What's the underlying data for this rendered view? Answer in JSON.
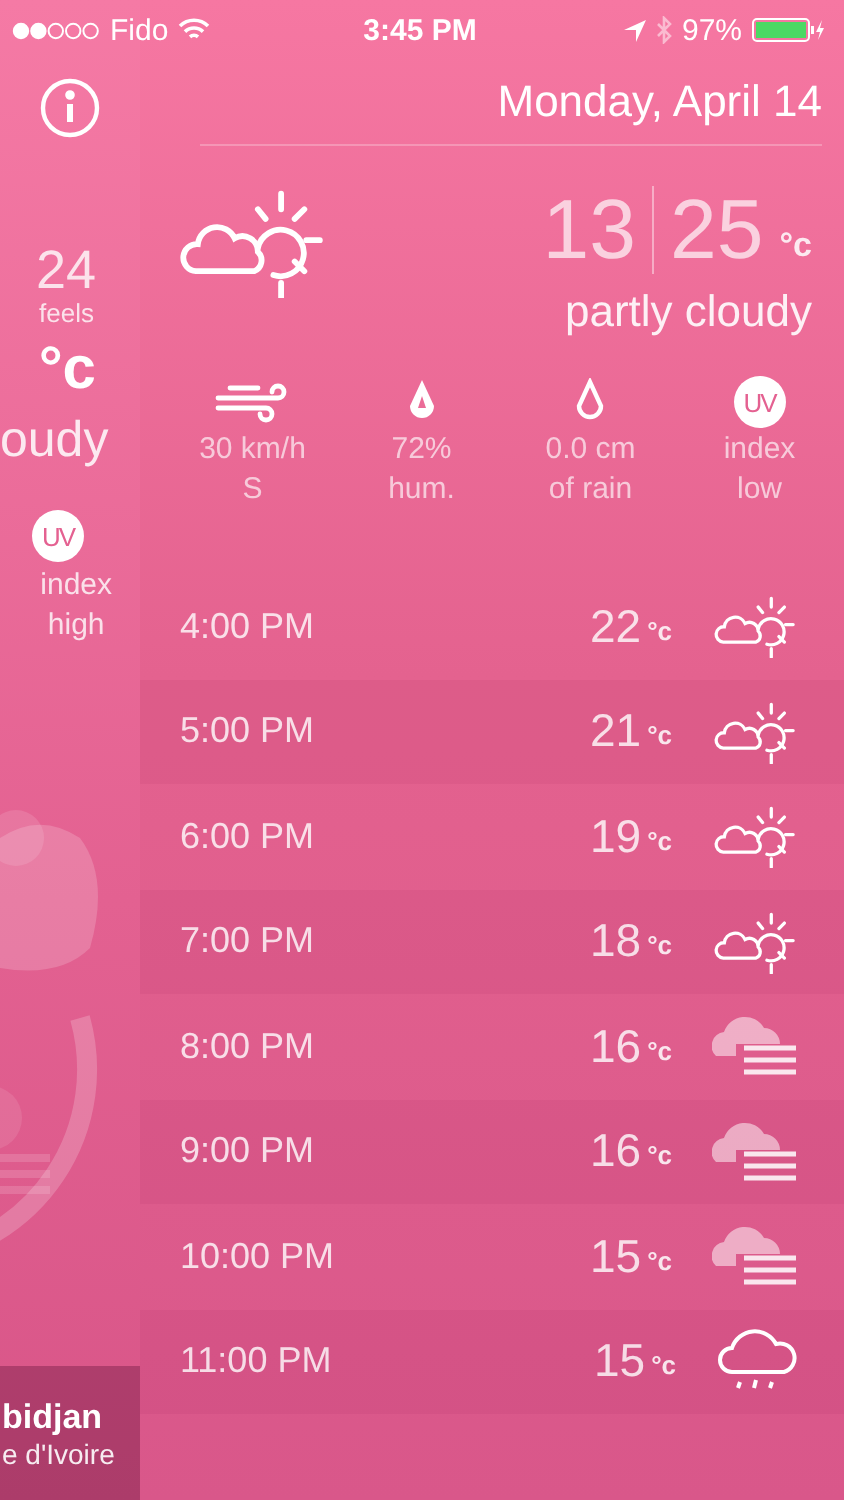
{
  "status_bar": {
    "carrier": "Fido",
    "time": "3:45 PM",
    "battery": "97%"
  },
  "back_panel": {
    "feels_value": "24",
    "feels_label": "feels",
    "unit": "°c",
    "condition": "oudy",
    "uv_badge": "UV",
    "uv_lines": [
      "index",
      "high"
    ],
    "city": "bidjan",
    "country": "e d'Ivoire"
  },
  "main": {
    "date": "Monday, April 14",
    "icon": {
      "kind": "partly-cloudy"
    },
    "low": "13",
    "high": "25",
    "unit": "°c",
    "condition": "partly cloudy",
    "details": [
      {
        "kind": "wind",
        "lines": [
          "30 km/h",
          "S"
        ]
      },
      {
        "kind": "humidity",
        "lines": [
          "72%",
          "hum."
        ]
      },
      {
        "kind": "rain",
        "lines": [
          "0.0 cm",
          "of rain"
        ]
      },
      {
        "kind": "uv",
        "badge": "UV",
        "lines": [
          "index",
          "low"
        ]
      }
    ],
    "hourly": [
      {
        "time": "4:00 PM",
        "temp": "22",
        "unit": "°c",
        "kind": "partly-cloudy"
      },
      {
        "time": "5:00 PM",
        "temp": "21",
        "unit": "°c",
        "kind": "partly-cloudy"
      },
      {
        "time": "6:00 PM",
        "temp": "19",
        "unit": "°c",
        "kind": "partly-cloudy"
      },
      {
        "time": "7:00 PM",
        "temp": "18",
        "unit": "°c",
        "kind": "partly-cloudy"
      },
      {
        "time": "8:00 PM",
        "temp": "16",
        "unit": "°c",
        "kind": "fog"
      },
      {
        "time": "9:00 PM",
        "temp": "16",
        "unit": "°c",
        "kind": "fog"
      },
      {
        "time": "10:00 PM",
        "temp": "15",
        "unit": "°c",
        "kind": "fog"
      },
      {
        "time": "11:00 PM",
        "temp": "15",
        "unit": "°c",
        "kind": "rain"
      }
    ]
  }
}
